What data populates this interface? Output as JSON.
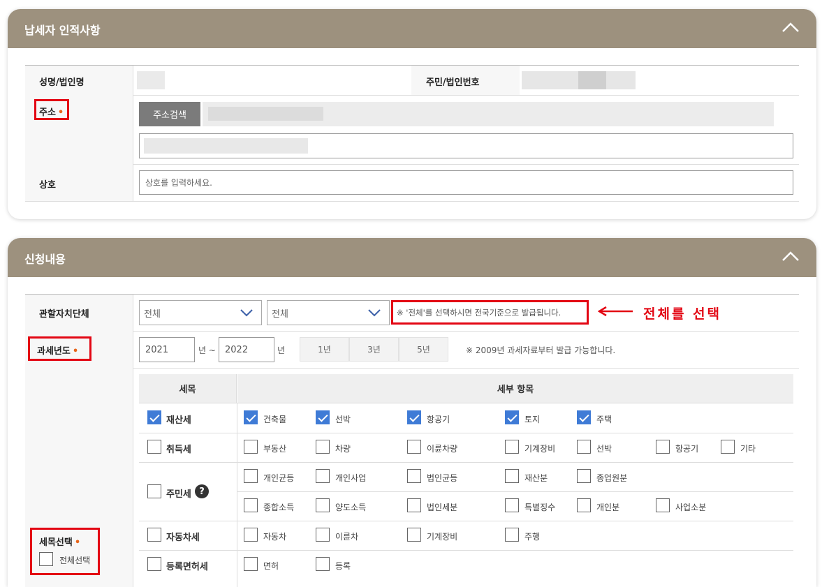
{
  "panel1": {
    "title": "납세자 인적사항",
    "name_label": "성명/법인명",
    "id_label": "주민/법인번호",
    "address_label": "주소",
    "address_required": "•",
    "address_search_button": "주소검색",
    "business_label": "상호",
    "business_placeholder": "상호를 입력하세요."
  },
  "panel2": {
    "title": "신청내용",
    "authority_label": "관할자치단체",
    "select1_value": "전체",
    "select2_value": "전체",
    "authority_note": "※ '전체'를 선택하시면 전국기준으로 발급됩니다.",
    "annotation": "전체를 선택",
    "year_label": "과세년도",
    "year_required": "•",
    "year_from": "2021",
    "year_unit": "년",
    "tilde": "~",
    "year_to": "2022",
    "year_unit2": "년",
    "periods": [
      "1년",
      "3년",
      "5년"
    ],
    "year_note": "※ 2009년 과세자료부터 발급 가능합니다.",
    "tax_select_label": "세목선택",
    "tax_select_required": "•",
    "select_all_label": "전체선택",
    "table": {
      "col1": "세목",
      "col2": "세부 항목",
      "rows": [
        {
          "name": "재산세",
          "checked": true,
          "items": [
            "건축물",
            "선박",
            "항공기",
            "토지",
            "주택"
          ]
        },
        {
          "name": "취득세",
          "checked": false,
          "items": [
            "부동산",
            "차량",
            "이륜차량",
            "기계장비",
            "선박",
            "항공기",
            "기타"
          ]
        },
        {
          "name": "주민세",
          "checked": false,
          "help": "?",
          "items": [
            "개인균등",
            "개인사업",
            "법인균등",
            "재산분",
            "종업원분",
            "종합소득",
            "양도소득",
            "법인세분",
            "특별징수",
            "개인분",
            "사업소분"
          ]
        },
        {
          "name": "자동차세",
          "checked": false,
          "items": [
            "자동차",
            "이륜차",
            "기계장비",
            "주행"
          ]
        },
        {
          "name": "등록면허세",
          "checked": false,
          "items": [
            "면허",
            "등록"
          ]
        }
      ]
    }
  },
  "colors": {
    "header": "#9d917e",
    "accent_check": "#3f7bd6",
    "annotation_red": "#e30613"
  }
}
